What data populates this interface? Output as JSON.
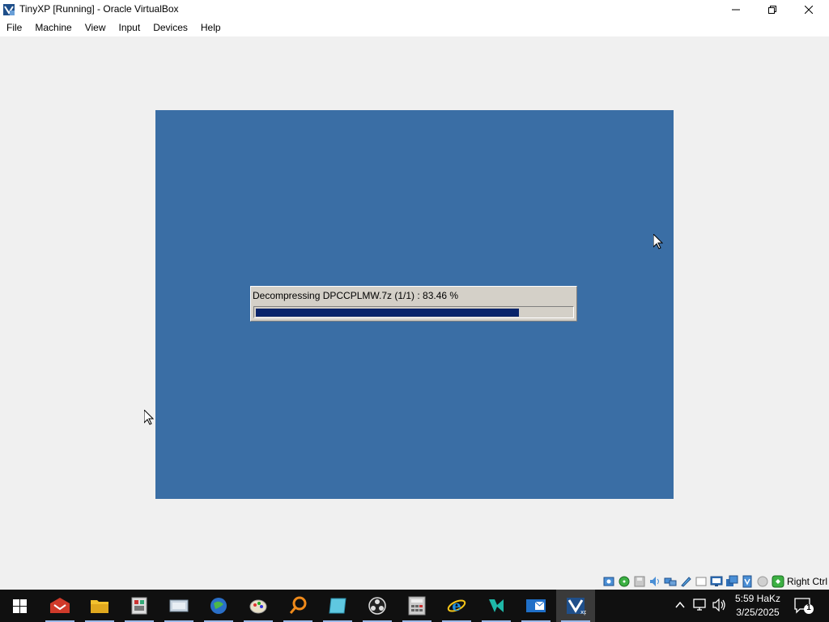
{
  "window": {
    "title": "TinyXP [Running] - Oracle VirtualBox"
  },
  "menu": {
    "items": [
      "File",
      "Machine",
      "View",
      "Input",
      "Devices",
      "Help"
    ]
  },
  "vm": {
    "background_color": "#3a6ea5",
    "progress": {
      "label": "Decompressing DPCCPLMW.7z  (1/1) : 83.46 %",
      "value": 0.8346,
      "fill_color": "#0a246a"
    }
  },
  "status_bar": {
    "icons": [
      "hard-disk-icon",
      "optical-drive-icon",
      "floppy-icon",
      "audio-icon",
      "network-icon",
      "usb-icon",
      "shared-folders-icon",
      "display-icon",
      "video-capture-icon",
      "recording-icon",
      "cpu-icon",
      "mouse-integration-icon",
      "keyboard-icon"
    ],
    "host_key": "Right Ctrl"
  },
  "taskbar": {
    "apps": [
      "app-red-icon",
      "file-explorer-icon",
      "archive-manager-icon",
      "disk-tool-icon",
      "globe-icon",
      "paint-icon",
      "search-magnifier-icon",
      "notes-icon",
      "obs-icon",
      "calculator-icon",
      "internet-explorer-icon",
      "visual-studio-icon",
      "outlook-icon",
      "virtualbox-icon"
    ],
    "clock_time": "5:59 HaKz",
    "clock_date": "3/25/2025",
    "notification_count": "1"
  }
}
